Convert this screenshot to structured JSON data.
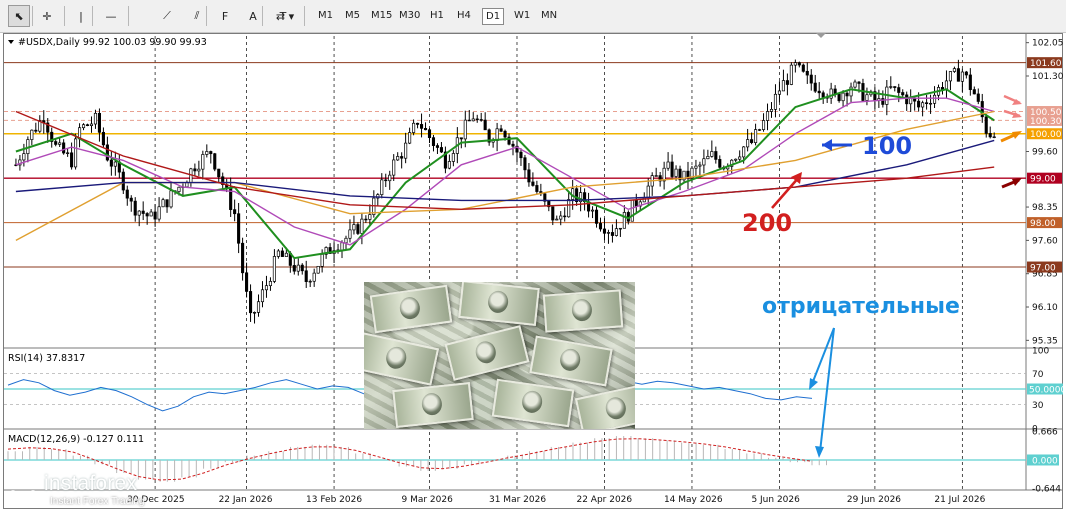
{
  "toolbar": {
    "tools": [
      {
        "name": "cursor-tool",
        "icon": "cursor-arrow-icon",
        "glyph": "⬉",
        "selected": true
      },
      {
        "name": "crosshair-tool",
        "icon": "crosshair-icon",
        "glyph": "✛",
        "selected": false
      },
      {
        "name": "vertical-line-tool",
        "icon": "vertical-line-icon",
        "glyph": "|",
        "selected": false
      },
      {
        "name": "horizontal-line-tool",
        "icon": "horizontal-line-icon",
        "glyph": "—",
        "selected": false
      },
      {
        "name": "trendline-tool",
        "icon": "trendline-icon",
        "glyph": "⟋",
        "selected": false
      },
      {
        "name": "channel-tool",
        "icon": "channel-icon",
        "glyph": "⫽",
        "selected": false
      },
      {
        "name": "fibonacci-tool",
        "icon": "fibonacci-icon",
        "glyph": "F",
        "selected": false
      },
      {
        "name": "text-tool",
        "icon": "text-icon",
        "glyph": "A",
        "selected": false
      },
      {
        "name": "text-label-tool",
        "icon": "text-label-icon",
        "glyph": "T",
        "selected": false
      },
      {
        "name": "shapes-tool",
        "icon": "shapes-icon",
        "glyph": "⇄ ▾",
        "selected": false
      }
    ],
    "timeframes": [
      "M1",
      "M5",
      "M15",
      "M30",
      "H1",
      "H4",
      "D1",
      "W1",
      "MN"
    ],
    "active_timeframe": "D1"
  },
  "chart_header": {
    "symbol_line": "#USDX,Daily  99.92 100.03 99.90 99.93"
  },
  "price_axis": {
    "ticks": [
      "102.05",
      "101.30",
      "99.60",
      "98.35",
      "97.60",
      "96.85",
      "96.10",
      "95.35"
    ],
    "level_labels": [
      {
        "text": "101.60",
        "value": 101.6,
        "color": "#8b3a1e"
      },
      {
        "text": "100.50",
        "value": 100.5,
        "color": "#e8a090"
      },
      {
        "text": "100.30",
        "value": 100.3,
        "color": "#e8a090"
      },
      {
        "text": "100.00",
        "value": 100.0,
        "color": "#f5a000"
      },
      {
        "text": "99.00",
        "value": 99.0,
        "color": "#b00020"
      },
      {
        "text": "98.00",
        "value": 98.0,
        "color": "#c0602a"
      },
      {
        "text": "97.00",
        "value": 97.0,
        "color": "#8b3a1e"
      }
    ]
  },
  "rsi_panel": {
    "label": "RSI(14) 37.8317",
    "ticks": [
      "100",
      "70",
      "50.0000",
      "30",
      "0"
    ],
    "current": 37.8317
  },
  "macd_panel": {
    "label": "MACD(12,26,9) -0.127 0.111",
    "ticks": [
      "0.666",
      "0.000",
      "-0.644"
    ]
  },
  "time_axis": {
    "labels": [
      "30 Dec 2025",
      "22 Jan 2026",
      "13 Feb 2026",
      "9 Mar 2026",
      "31 Mar 2026",
      "22 Apr 2026",
      "14 May 2026",
      "5 Jun 2026",
      "29 Jun 2026",
      "21 Jul 2026"
    ]
  },
  "annotations": {
    "ma100_label": "100",
    "ma200_label": "200",
    "negative_label": "отрицательные",
    "blue_color": "#1e4bd8",
    "red_color": "#d21f1f",
    "cyan_color": "#1a8fe0"
  },
  "watermark": {
    "brand": "instaforex",
    "tagline": "Instant Forex Trading"
  },
  "chart_data": {
    "type": "candlestick",
    "symbol": "#USDX",
    "timeframe": "Daily",
    "ohlc_last": {
      "open": 99.92,
      "high": 100.03,
      "low": 99.9,
      "close": 99.93
    },
    "ylim": [
      95.2,
      102.2
    ],
    "x_labels": [
      "30 Dec 2025",
      "22 Jan 2026",
      "13 Feb 2026",
      "9 Mar 2026",
      "31 Mar 2026",
      "22 Apr 2026",
      "14 May 2026",
      "5 Jun 2026",
      "29 Jun 2026",
      "21 Jul 2026"
    ],
    "close_path": [
      {
        "x": "2025-11-25",
        "y": 99.3
      },
      {
        "x": "2025-11-28",
        "y": 99.9
      },
      {
        "x": "2025-12-02",
        "y": 100.4
      },
      {
        "x": "2025-12-05",
        "y": 99.7
      },
      {
        "x": "2025-12-09",
        "y": 99.4
      },
      {
        "x": "2025-12-11",
        "y": 100.1
      },
      {
        "x": "2025-12-15",
        "y": 100.3
      },
      {
        "x": "2025-12-18",
        "y": 99.5
      },
      {
        "x": "2025-12-22",
        "y": 98.9
      },
      {
        "x": "2025-12-24",
        "y": 98.4
      },
      {
        "x": "2025-12-29",
        "y": 98.1
      },
      {
        "x": "2026-01-02",
        "y": 98.5
      },
      {
        "x": "2026-01-06",
        "y": 98.9
      },
      {
        "x": "2026-01-09",
        "y": 99.3
      },
      {
        "x": "2026-01-13",
        "y": 99.6
      },
      {
        "x": "2026-01-15",
        "y": 99.1
      },
      {
        "x": "2026-01-19",
        "y": 98.2
      },
      {
        "x": "2026-01-21",
        "y": 96.9
      },
      {
        "x": "2026-01-23",
        "y": 95.8
      },
      {
        "x": "2026-01-27",
        "y": 96.6
      },
      {
        "x": "2026-01-30",
        "y": 97.3
      },
      {
        "x": "2026-02-03",
        "y": 97.0
      },
      {
        "x": "2026-02-06",
        "y": 96.7
      },
      {
        "x": "2026-02-10",
        "y": 97.2
      },
      {
        "x": "2026-02-13",
        "y": 97.5
      },
      {
        "x": "2026-02-17",
        "y": 97.7
      },
      {
        "x": "2026-02-20",
        "y": 98.0
      },
      {
        "x": "2026-02-24",
        "y": 98.6
      },
      {
        "x": "2026-02-27",
        "y": 99.2
      },
      {
        "x": "2026-03-03",
        "y": 99.7
      },
      {
        "x": "2026-03-06",
        "y": 100.3
      },
      {
        "x": "2026-03-10",
        "y": 99.8
      },
      {
        "x": "2026-03-13",
        "y": 99.4
      },
      {
        "x": "2026-03-17",
        "y": 100.0
      },
      {
        "x": "2026-03-20",
        "y": 100.4
      },
      {
        "x": "2026-03-24",
        "y": 99.9
      },
      {
        "x": "2026-03-27",
        "y": 100.2
      },
      {
        "x": "2026-03-31",
        "y": 99.6
      },
      {
        "x": "2026-04-03",
        "y": 99.0
      },
      {
        "x": "2026-04-07",
        "y": 98.4
      },
      {
        "x": "2026-04-10",
        "y": 98.0
      },
      {
        "x": "2026-04-14",
        "y": 98.6
      },
      {
        "x": "2026-04-17",
        "y": 98.5
      },
      {
        "x": "2026-04-21",
        "y": 98.0
      },
      {
        "x": "2026-04-24",
        "y": 97.8
      },
      {
        "x": "2026-04-28",
        "y": 98.2
      },
      {
        "x": "2026-05-01",
        "y": 98.6
      },
      {
        "x": "2026-05-05",
        "y": 99.0
      },
      {
        "x": "2026-05-08",
        "y": 99.2
      },
      {
        "x": "2026-05-12",
        "y": 99.0
      },
      {
        "x": "2026-05-15",
        "y": 99.2
      },
      {
        "x": "2026-05-19",
        "y": 99.5
      },
      {
        "x": "2026-05-22",
        "y": 99.3
      },
      {
        "x": "2026-05-27",
        "y": 99.7
      },
      {
        "x": "2026-05-29",
        "y": 99.8
      },
      {
        "x": "2026-06-02",
        "y": 100.4
      },
      {
        "x": "2026-06-05",
        "y": 101.0
      },
      {
        "x": "2026-06-09",
        "y": 101.5
      },
      {
        "x": "2026-06-12",
        "y": 101.2
      },
      {
        "x": "2026-06-16",
        "y": 101.0
      },
      {
        "x": "2026-06-19",
        "y": 100.8
      },
      {
        "x": "2026-06-23",
        "y": 101.1
      },
      {
        "x": "2026-06-26",
        "y": 100.9
      },
      {
        "x": "2026-06-30",
        "y": 100.7
      },
      {
        "x": "2026-07-03",
        "y": 101.0
      },
      {
        "x": "2026-07-07",
        "y": 100.8
      },
      {
        "x": "2026-07-10",
        "y": 100.6
      },
      {
        "x": "2026-07-14",
        "y": 100.9
      },
      {
        "x": "2026-07-17",
        "y": 101.2
      },
      {
        "x": "2026-07-21",
        "y": 101.4
      },
      {
        "x": "2026-07-24",
        "y": 100.9
      },
      {
        "x": "2026-07-27",
        "y": 100.1
      },
      {
        "x": "2026-07-29",
        "y": 99.93
      }
    ],
    "moving_averages": [
      {
        "period": "fast-green",
        "color": "#1f8f1f",
        "points": [
          [
            "2025-11-25",
            99.6
          ],
          [
            "2025-12-09",
            100.0
          ],
          [
            "2025-12-22",
            99.3
          ],
          [
            "2026-01-06",
            98.6
          ],
          [
            "2026-01-19",
            98.8
          ],
          [
            "2026-02-03",
            97.2
          ],
          [
            "2026-02-17",
            97.4
          ],
          [
            "2026-03-03",
            98.9
          ],
          [
            "2026-03-17",
            99.8
          ],
          [
            "2026-03-31",
            99.9
          ],
          [
            "2026-04-14",
            98.6
          ],
          [
            "2026-04-28",
            98.1
          ],
          [
            "2026-05-12",
            98.9
          ],
          [
            "2026-05-27",
            99.4
          ],
          [
            "2026-06-09",
            100.6
          ],
          [
            "2026-06-23",
            101.0
          ],
          [
            "2026-07-07",
            100.8
          ],
          [
            "2026-07-17",
            101.0
          ],
          [
            "2026-07-29",
            100.3
          ]
        ]
      },
      {
        "period": "slow-violet",
        "color": "#b04ab8",
        "points": [
          [
            "2025-11-25",
            99.3
          ],
          [
            "2025-12-09",
            99.7
          ],
          [
            "2025-12-22",
            99.4
          ],
          [
            "2026-01-06",
            98.8
          ],
          [
            "2026-01-19",
            98.7
          ],
          [
            "2026-02-03",
            97.9
          ],
          [
            "2026-02-17",
            97.5
          ],
          [
            "2026-03-03",
            98.3
          ],
          [
            "2026-03-17",
            99.3
          ],
          [
            "2026-03-31",
            99.7
          ],
          [
            "2026-04-14",
            99.0
          ],
          [
            "2026-04-28",
            98.3
          ],
          [
            "2026-05-12",
            98.7
          ],
          [
            "2026-05-27",
            99.2
          ],
          [
            "2026-06-09",
            100.0
          ],
          [
            "2026-06-23",
            100.7
          ],
          [
            "2026-07-07",
            100.8
          ],
          [
            "2026-07-17",
            100.8
          ],
          [
            "2026-07-29",
            100.5
          ]
        ]
      },
      {
        "period": "ma50-orange",
        "color": "#e0a030",
        "points": [
          [
            "2025-11-25",
            97.6
          ],
          [
            "2025-12-22",
            98.9
          ],
          [
            "2026-01-19",
            98.9
          ],
          [
            "2026-02-17",
            98.2
          ],
          [
            "2026-03-17",
            98.3
          ],
          [
            "2026-04-14",
            98.8
          ],
          [
            "2026-05-12",
            99.0
          ],
          [
            "2026-06-09",
            99.4
          ],
          [
            "2026-07-07",
            100.1
          ],
          [
            "2026-07-29",
            100.5
          ]
        ]
      },
      {
        "period": "ma100-navy",
        "color": "#1a1a7a",
        "points": [
          [
            "2025-11-25",
            98.7
          ],
          [
            "2025-12-22",
            98.9
          ],
          [
            "2026-01-19",
            98.9
          ],
          [
            "2026-02-17",
            98.6
          ],
          [
            "2026-03-17",
            98.5
          ],
          [
            "2026-04-14",
            98.5
          ],
          [
            "2026-05-12",
            98.6
          ],
          [
            "2026-06-09",
            98.8
          ],
          [
            "2026-07-07",
            99.3
          ],
          [
            "2026-07-29",
            99.85
          ]
        ]
      },
      {
        "period": "ma200-red",
        "color": "#b01818",
        "points": [
          [
            "2025-11-25",
            100.5
          ],
          [
            "2025-12-22",
            99.5
          ],
          [
            "2026-01-19",
            98.8
          ],
          [
            "2026-02-17",
            98.4
          ],
          [
            "2026-03-17",
            98.3
          ],
          [
            "2026-04-14",
            98.4
          ],
          [
            "2026-05-12",
            98.6
          ],
          [
            "2026-06-09",
            98.8
          ],
          [
            "2026-07-07",
            99.0
          ],
          [
            "2026-07-29",
            99.25
          ]
        ]
      }
    ],
    "horizontal_levels": [
      101.6,
      100.5,
      100.3,
      100.0,
      99.0,
      98.0,
      97.0
    ],
    "rsi_values": [
      55,
      62,
      58,
      48,
      42,
      46,
      52,
      48,
      40,
      30,
      22,
      28,
      40,
      46,
      44,
      48,
      52,
      58,
      62,
      56,
      50,
      54,
      52,
      44,
      38,
      40,
      44,
      48,
      54,
      58,
      52,
      48,
      46,
      50,
      54,
      56,
      58,
      62,
      66,
      64,
      60,
      56,
      60,
      58,
      54,
      50,
      52,
      48,
      44,
      38,
      36,
      40,
      38
    ],
    "macd_histogram": [
      0.2,
      0.3,
      0.25,
      0.1,
      -0.1,
      -0.3,
      -0.45,
      -0.5,
      -0.4,
      -0.2,
      -0.05,
      0.1,
      0.2,
      0.3,
      0.35,
      0.3,
      0.15,
      0.0,
      -0.15,
      -0.25,
      -0.2,
      -0.1,
      0.0,
      0.1,
      0.2,
      0.3,
      0.4,
      0.5,
      0.55,
      0.5,
      0.45,
      0.4,
      0.35,
      0.25,
      0.15,
      0.05,
      -0.05,
      -0.12
    ],
    "macd_signal": [
      0.25,
      0.28,
      0.26,
      0.18,
      0.0,
      -0.2,
      -0.38,
      -0.46,
      -0.44,
      -0.3,
      -0.12,
      0.02,
      0.14,
      0.24,
      0.3,
      0.3,
      0.22,
      0.08,
      -0.06,
      -0.18,
      -0.2,
      -0.14,
      -0.05,
      0.05,
      0.14,
      0.24,
      0.33,
      0.42,
      0.48,
      0.49,
      0.46,
      0.42,
      0.37,
      0.3,
      0.21,
      0.12,
      0.04,
      -0.03
    ]
  }
}
